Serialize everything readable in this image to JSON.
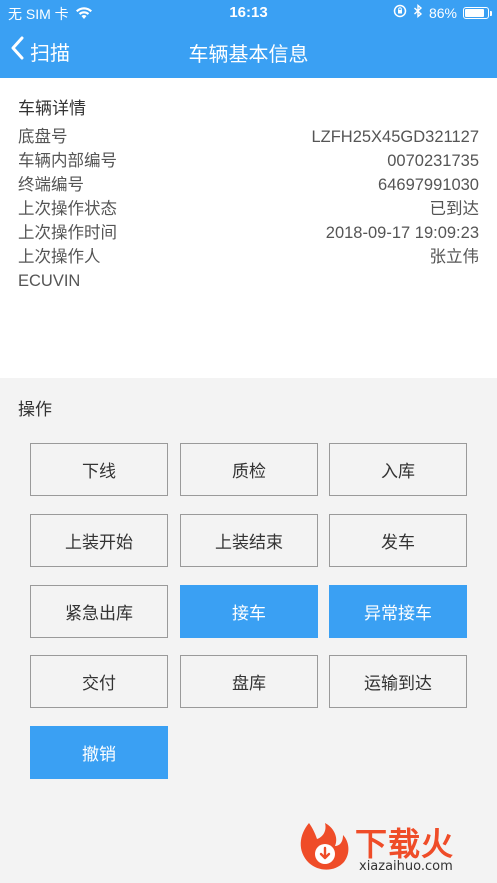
{
  "status_bar": {
    "carrier": "无 SIM 卡",
    "time": "16:13",
    "battery_percent": "86%",
    "battery_level": 0.86,
    "icons": [
      "wifi-icon",
      "orientation-lock-icon",
      "bluetooth-icon",
      "battery-icon"
    ]
  },
  "nav": {
    "back_label": "扫描",
    "title": "车辆基本信息",
    "back_icon": "chevron-left-icon"
  },
  "details": {
    "heading": "车辆详情",
    "rows": [
      {
        "label": "底盘号",
        "value": "LZFH25X45GD321127"
      },
      {
        "label": "车辆内部编号",
        "value": "0070231735"
      },
      {
        "label": "终端编号",
        "value": "64697991030"
      },
      {
        "label": "上次操作状态",
        "value": "已到达"
      },
      {
        "label": "上次操作时间",
        "value": "2018-09-17 19:09:23"
      },
      {
        "label": "上次操作人",
        "value": "张立伟"
      },
      {
        "label": "ECUVIN",
        "value": ""
      }
    ]
  },
  "operations": {
    "heading": "操作",
    "buttons": [
      {
        "label": "下线",
        "primary": false
      },
      {
        "label": "质检",
        "primary": false
      },
      {
        "label": "入库",
        "primary": false
      },
      {
        "label": "上装开始",
        "primary": false
      },
      {
        "label": "上装结束",
        "primary": false
      },
      {
        "label": "发车",
        "primary": false
      },
      {
        "label": "紧急出库",
        "primary": false
      },
      {
        "label": "接车",
        "primary": true
      },
      {
        "label": "异常接车",
        "primary": true
      },
      {
        "label": "交付",
        "primary": false
      },
      {
        "label": "盘库",
        "primary": false
      },
      {
        "label": "运输到达",
        "primary": false
      },
      {
        "label": "撤销",
        "primary": true
      }
    ]
  },
  "watermark": {
    "text": "下载火",
    "url": "xiazaihuo.com"
  },
  "colors": {
    "accent": "#3aa0f3",
    "watermark": "#ef4c28"
  }
}
